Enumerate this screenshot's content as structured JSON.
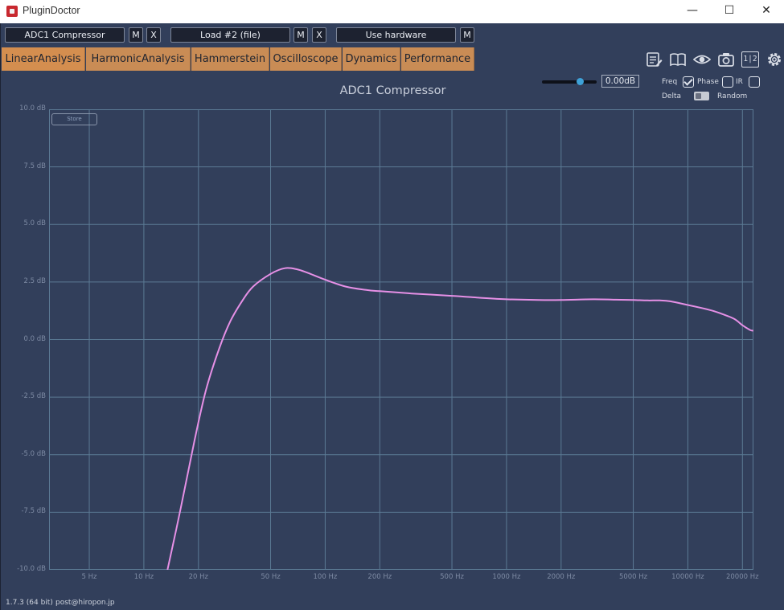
{
  "window": {
    "title": "PluginDoctor",
    "minimize": "—",
    "maximize": "☐",
    "close": "✕"
  },
  "toolbar": {
    "plugin_slot": "ADC1 Compressor",
    "plugin_m": "M",
    "plugin_x": "X",
    "load_slot": "Load #2 (file)",
    "load_m": "M",
    "load_x": "X",
    "hardware": "Use hardware",
    "hardware_m": "M"
  },
  "tabs": [
    {
      "label": "LinearAnalysis",
      "active": true
    },
    {
      "label": "HarmonicAnalysis",
      "active": false
    },
    {
      "label": "Hammerstein",
      "active": false
    },
    {
      "label": "Oscilloscope",
      "active": false
    },
    {
      "label": "Dynamics",
      "active": false
    },
    {
      "label": "Performance",
      "active": false
    }
  ],
  "tool_icons": [
    "notes-icon",
    "book-icon",
    "eye-icon",
    "camera-icon",
    "compare-icon",
    "gear-icon"
  ],
  "tool_icon_texts": {
    "compare": "1|2"
  },
  "controls": {
    "level_value": "0.00dB",
    "level_fraction": 0.65,
    "freq_label": "Freq",
    "freq_checked": true,
    "phase_label": "Phase",
    "phase_checked": false,
    "ir_label": "IR",
    "ir_checked": false,
    "delta_label": "Delta",
    "random_label": "Random",
    "random_on": false
  },
  "plot": {
    "store_label": "Store"
  },
  "footer": {
    "version": "1.7.3 (64 bit)",
    "contact": "post@hiropon.jp"
  },
  "colors": {
    "background": "#323f5b",
    "grid": "#5b7a94",
    "curve": "#e690e6",
    "tab": "#c98c55"
  },
  "chart_data": {
    "type": "line",
    "title": "ADC1 Compressor",
    "x_scale": "log",
    "xlim": [
      3,
      23000
    ],
    "ylim": [
      -10,
      10
    ],
    "x_ticks": [
      5,
      10,
      20,
      50,
      100,
      200,
      500,
      1000,
      2000,
      5000,
      10000,
      20000
    ],
    "x_tick_labels": [
      "5 Hz",
      "10 Hz",
      "20 Hz",
      "50 Hz",
      "100 Hz",
      "200 Hz",
      "500 Hz",
      "1000 Hz",
      "2000 Hz",
      "5000 Hz",
      "10000 Hz",
      "20000 Hz"
    ],
    "y_ticks": [
      10,
      7.5,
      5,
      2.5,
      0,
      -2.5,
      -5,
      -7.5,
      -10
    ],
    "y_tick_labels": [
      "10.0 dB",
      "7.5 dB",
      "5.0 dB",
      "2.5 dB",
      "0.0 dB",
      "-2.5 dB",
      "-5.0 dB",
      "-7.5 dB",
      "-10.0 dB"
    ],
    "grid": true,
    "series": [
      {
        "x": [
          13.5,
          16,
          19,
          22,
          26,
          30,
          35,
          40,
          50,
          60,
          70,
          80,
          100,
          130,
          170,
          200,
          300,
          500,
          700,
          1000,
          1500,
          2000,
          3000,
          4000,
          5000,
          6000,
          7000,
          8000,
          10000,
          13000,
          15000,
          18000,
          20000,
          22000,
          23000
        ],
        "y": [
          -10,
          -7.3,
          -4.4,
          -2.2,
          -0.4,
          0.8,
          1.7,
          2.3,
          2.85,
          3.1,
          3.05,
          2.9,
          2.6,
          2.3,
          2.15,
          2.1,
          2.0,
          1.9,
          1.82,
          1.75,
          1.72,
          1.72,
          1.75,
          1.73,
          1.72,
          1.7,
          1.7,
          1.66,
          1.5,
          1.3,
          1.15,
          0.9,
          0.62,
          0.42,
          0.38
        ]
      }
    ]
  }
}
